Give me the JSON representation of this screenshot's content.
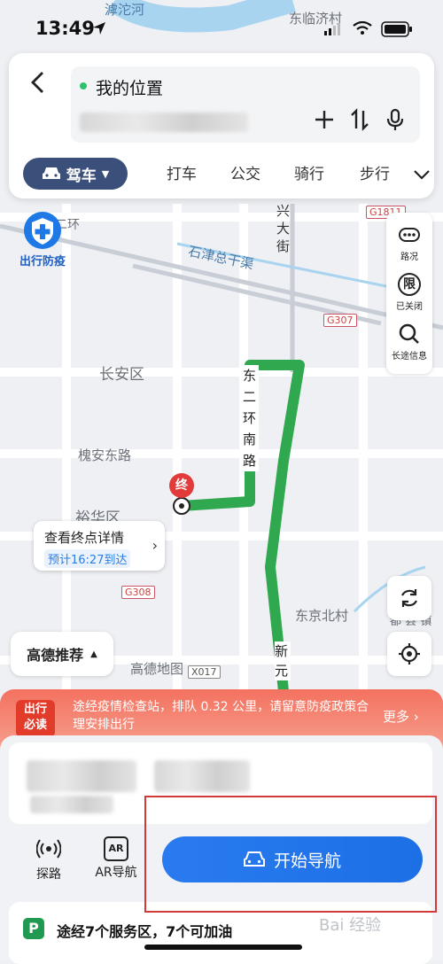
{
  "status_bar": {
    "time": "13:49"
  },
  "search": {
    "origin": "我的位置",
    "add_icon": "plus-icon",
    "swap_icon": "swap-icon",
    "voice_icon": "mic-icon"
  },
  "modes": {
    "active": "驾车",
    "tabs": [
      "打车",
      "公交",
      "骑行",
      "步行"
    ]
  },
  "map": {
    "labels": {
      "river": "滹沱河",
      "village_top": "东临济村",
      "ring": "二环",
      "canal": "石津总干渠",
      "district": "长安区",
      "road_huaian": "槐安东路",
      "district2": "裕华区",
      "village": "东京北村",
      "logo": "高德地图",
      "jianhu": "都 县 镇",
      "street": "兴 大 街",
      "road_vertical": "东二环南路",
      "road_xinyuan": "新 元"
    },
    "shields": [
      "G1811",
      "G307",
      "G308",
      "X017"
    ],
    "epidemic_badge": "出行防疫",
    "end_marker": "终"
  },
  "right_tools": [
    {
      "label": "路况",
      "icon": "traffic-icon"
    },
    {
      "label": "已关闭",
      "icon": "restrict-icon",
      "glyph": "限"
    },
    {
      "label": "长途信息",
      "icon": "search-icon"
    }
  ],
  "destination": {
    "title": "查看终点详情",
    "eta": "预计16:27到达"
  },
  "recommend": {
    "label": "高德推荐"
  },
  "notice": {
    "badge_line1": "出行",
    "badge_line2": "必读",
    "text": "途经疫情检查站，排队 0.32 公里，请留意防疫政策合理安排出行",
    "more": "更多"
  },
  "actions": {
    "probe": "探路",
    "ar_nav": "AR导航",
    "ar_glyph": "AR",
    "start": "开始导航"
  },
  "service": {
    "icon_glyph": "P",
    "text": "途经7个服务区，7个可加油"
  },
  "watermark": "Bai 经验",
  "colors": {
    "route_green": "#2fa84f",
    "accent_blue": "#2a7bef",
    "notice_red": "#f4715f"
  }
}
